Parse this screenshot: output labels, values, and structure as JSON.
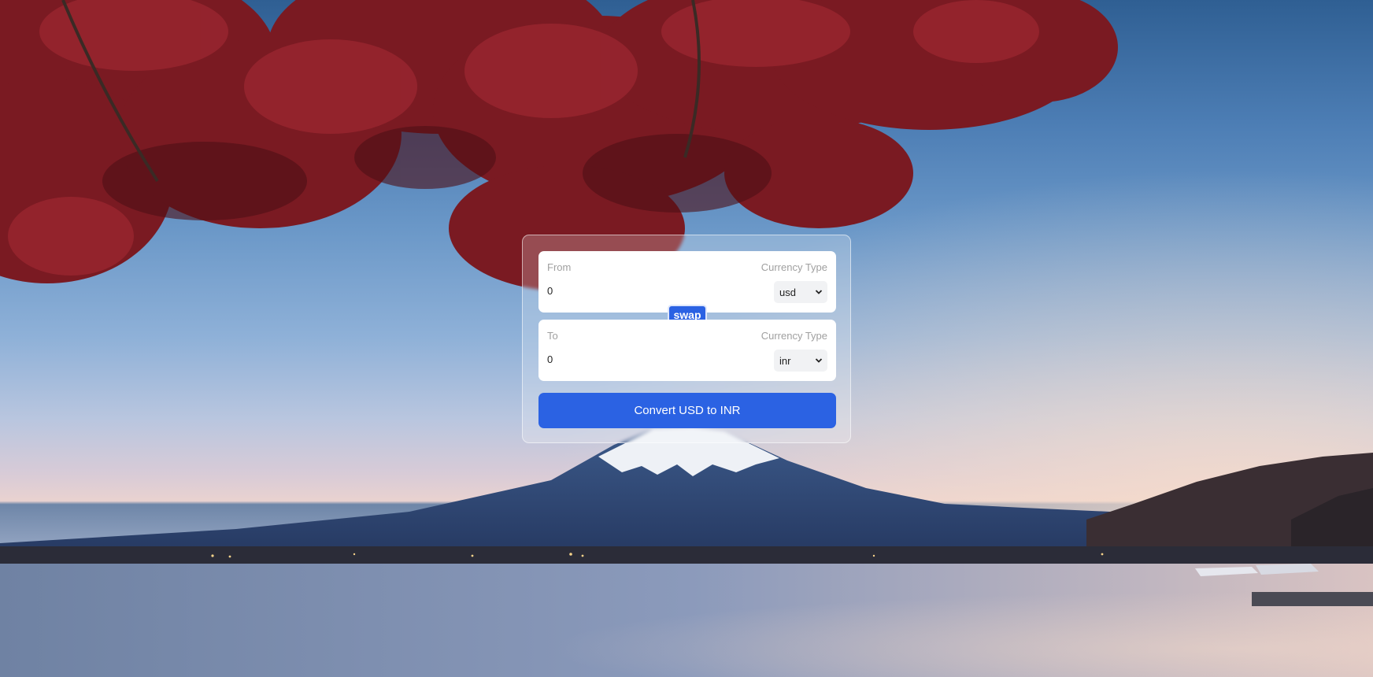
{
  "converter": {
    "from": {
      "label": "From",
      "currency_label": "Currency Type",
      "amount": "0",
      "currency": "usd"
    },
    "swap_label": "swap",
    "to": {
      "label": "To",
      "currency_label": "Currency Type",
      "amount": "0",
      "currency": "inr"
    },
    "convert_label": "Convert USD to INR"
  },
  "colors": {
    "accent": "#2b62e3",
    "card_bg": "#ffffff",
    "select_bg": "#f1f2f4"
  },
  "icons": {
    "select_arrow": "chevron-down-icon"
  }
}
